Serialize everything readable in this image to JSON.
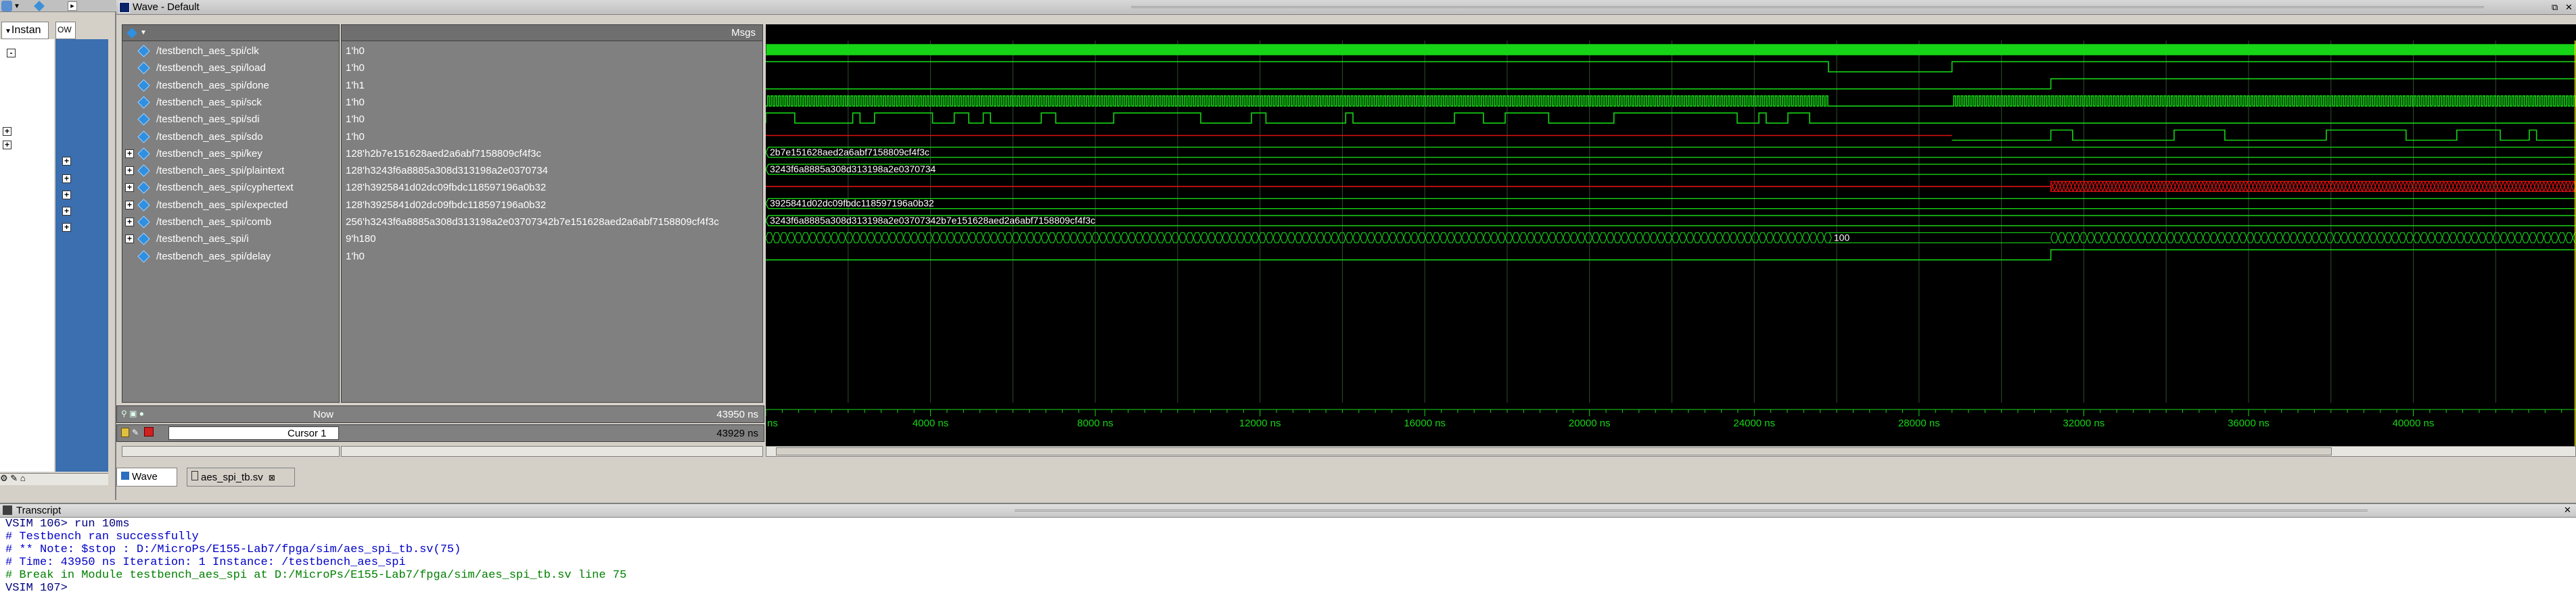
{
  "left_panel": {
    "tab_label": "Instan",
    "expand_marks": [
      "-",
      "+",
      "+",
      "+",
      "+",
      "+",
      "+",
      "+"
    ]
  },
  "wave_window": {
    "title": "Wave - Default",
    "msgs_header": "Msgs",
    "signals": [
      {
        "name": "/testbench_aes_spi/clk",
        "value": "1'h0",
        "expandable": false
      },
      {
        "name": "/testbench_aes_spi/load",
        "value": "1'h0",
        "expandable": false
      },
      {
        "name": "/testbench_aes_spi/done",
        "value": "1'h1",
        "expandable": false
      },
      {
        "name": "/testbench_aes_spi/sck",
        "value": "1'h0",
        "expandable": false
      },
      {
        "name": "/testbench_aes_spi/sdi",
        "value": "1'h0",
        "expandable": false
      },
      {
        "name": "/testbench_aes_spi/sdo",
        "value": "1'h0",
        "expandable": false
      },
      {
        "name": "/testbench_aes_spi/key",
        "value": "128'h2b7e151628aed2a6abf7158809cf4f3c",
        "expandable": true
      },
      {
        "name": "/testbench_aes_spi/plaintext",
        "value": "128'h3243f6a8885a308d313198a2e0370734",
        "expandable": true
      },
      {
        "name": "/testbench_aes_spi/cyphertext",
        "value": "128'h3925841d02dc09fbdc118597196a0b32",
        "expandable": true
      },
      {
        "name": "/testbench_aes_spi/expected",
        "value": "128'h3925841d02dc09fbdc118597196a0b32",
        "expandable": true
      },
      {
        "name": "/testbench_aes_spi/comb",
        "value": "256'h3243f6a8885a308d313198a2e03707342b7e151628aed2a6abf7158809cf4f3c",
        "expandable": true
      },
      {
        "name": "/testbench_aes_spi/i",
        "value": "9'h180",
        "expandable": true
      },
      {
        "name": "/testbench_aes_spi/delay",
        "value": "1'h0",
        "expandable": false
      }
    ],
    "wave_labels": {
      "key": "2b7e151628aed2a6abf7158809cf4f3c",
      "plaintext": "3243f6a8885a308d313198a2e0370734",
      "expected": "3925841d02dc09fbdc118597196a0b32",
      "comb": "3243f6a8885a308d313198a2e03707342b7e151628aed2a6abf7158809cf4f3c",
      "i": "100"
    },
    "now_label": "Now",
    "now_value": "43950 ns",
    "cursor_label": "Cursor 1",
    "cursor_value": "43929 ns",
    "timeline": {
      "start_label": "ns",
      "ticks": [
        "4000 ns",
        "8000 ns",
        "12000 ns",
        "16000 ns",
        "20000 ns",
        "24000 ns",
        "28000 ns",
        "32000 ns",
        "36000 ns",
        "40000 ns"
      ]
    },
    "tabs": [
      "Wave",
      "aes_spi_tb.sv"
    ]
  },
  "transcript": {
    "title": "Transcript",
    "lines": [
      {
        "text": "VSIM 106> run 10ms",
        "color": "#000080"
      },
      {
        "text": "# Testbench ran successfully",
        "color": "#0000c8"
      },
      {
        "text": "# ** Note: $stop    : D:/MicroPs/E155-Lab7/fpga/sim/aes_spi_tb.sv(75)",
        "color": "#0000c8"
      },
      {
        "text": "#    Time: 43950 ns  Iteration: 1  Instance: /testbench_aes_spi",
        "color": "#0000c8"
      },
      {
        "text": "# Break in Module testbench_aes_spi at D:/MicroPs/E155-Lab7/fpga/sim/aes_spi_tb.sv line 75",
        "color": "#008000"
      },
      {
        "text": "VSIM 107>",
        "color": "#000080"
      }
    ]
  },
  "colors": {
    "wave": "#16d416",
    "bus": "#16d416",
    "x_bus": "#e01010",
    "titlebar": "#0a246a"
  }
}
